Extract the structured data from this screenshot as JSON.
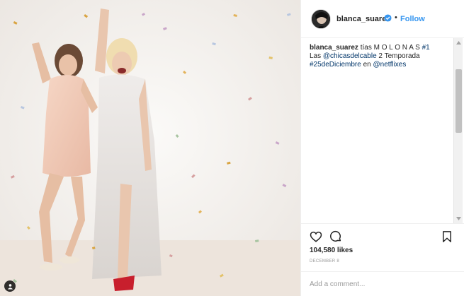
{
  "post": {
    "author": "blanca_suarez",
    "follow_label": "Follow",
    "separator": "•",
    "caption": {
      "text_1": "tías M O L O N A S ",
      "hashtag_1": "#1",
      "text_2": "Las ",
      "mention_1": "@chicasdelcable",
      "text_3": " 2 Temporada",
      "hashtag_2": "#25deDiciembre",
      "text_4": " en ",
      "mention_2": "@netflixes"
    },
    "likes": "104,580 likes",
    "date": "DECEMBER 8",
    "comment_placeholder": "Add a comment..."
  },
  "icons": {
    "verified": "verified-badge-icon",
    "like": "heart-icon",
    "comment": "comment-bubble-icon",
    "save": "bookmark-icon",
    "user_tag": "user-tag-icon"
  },
  "colors": {
    "link": "#3897f0",
    "mention": "#003569",
    "text": "#262626",
    "muted": "#999999"
  }
}
